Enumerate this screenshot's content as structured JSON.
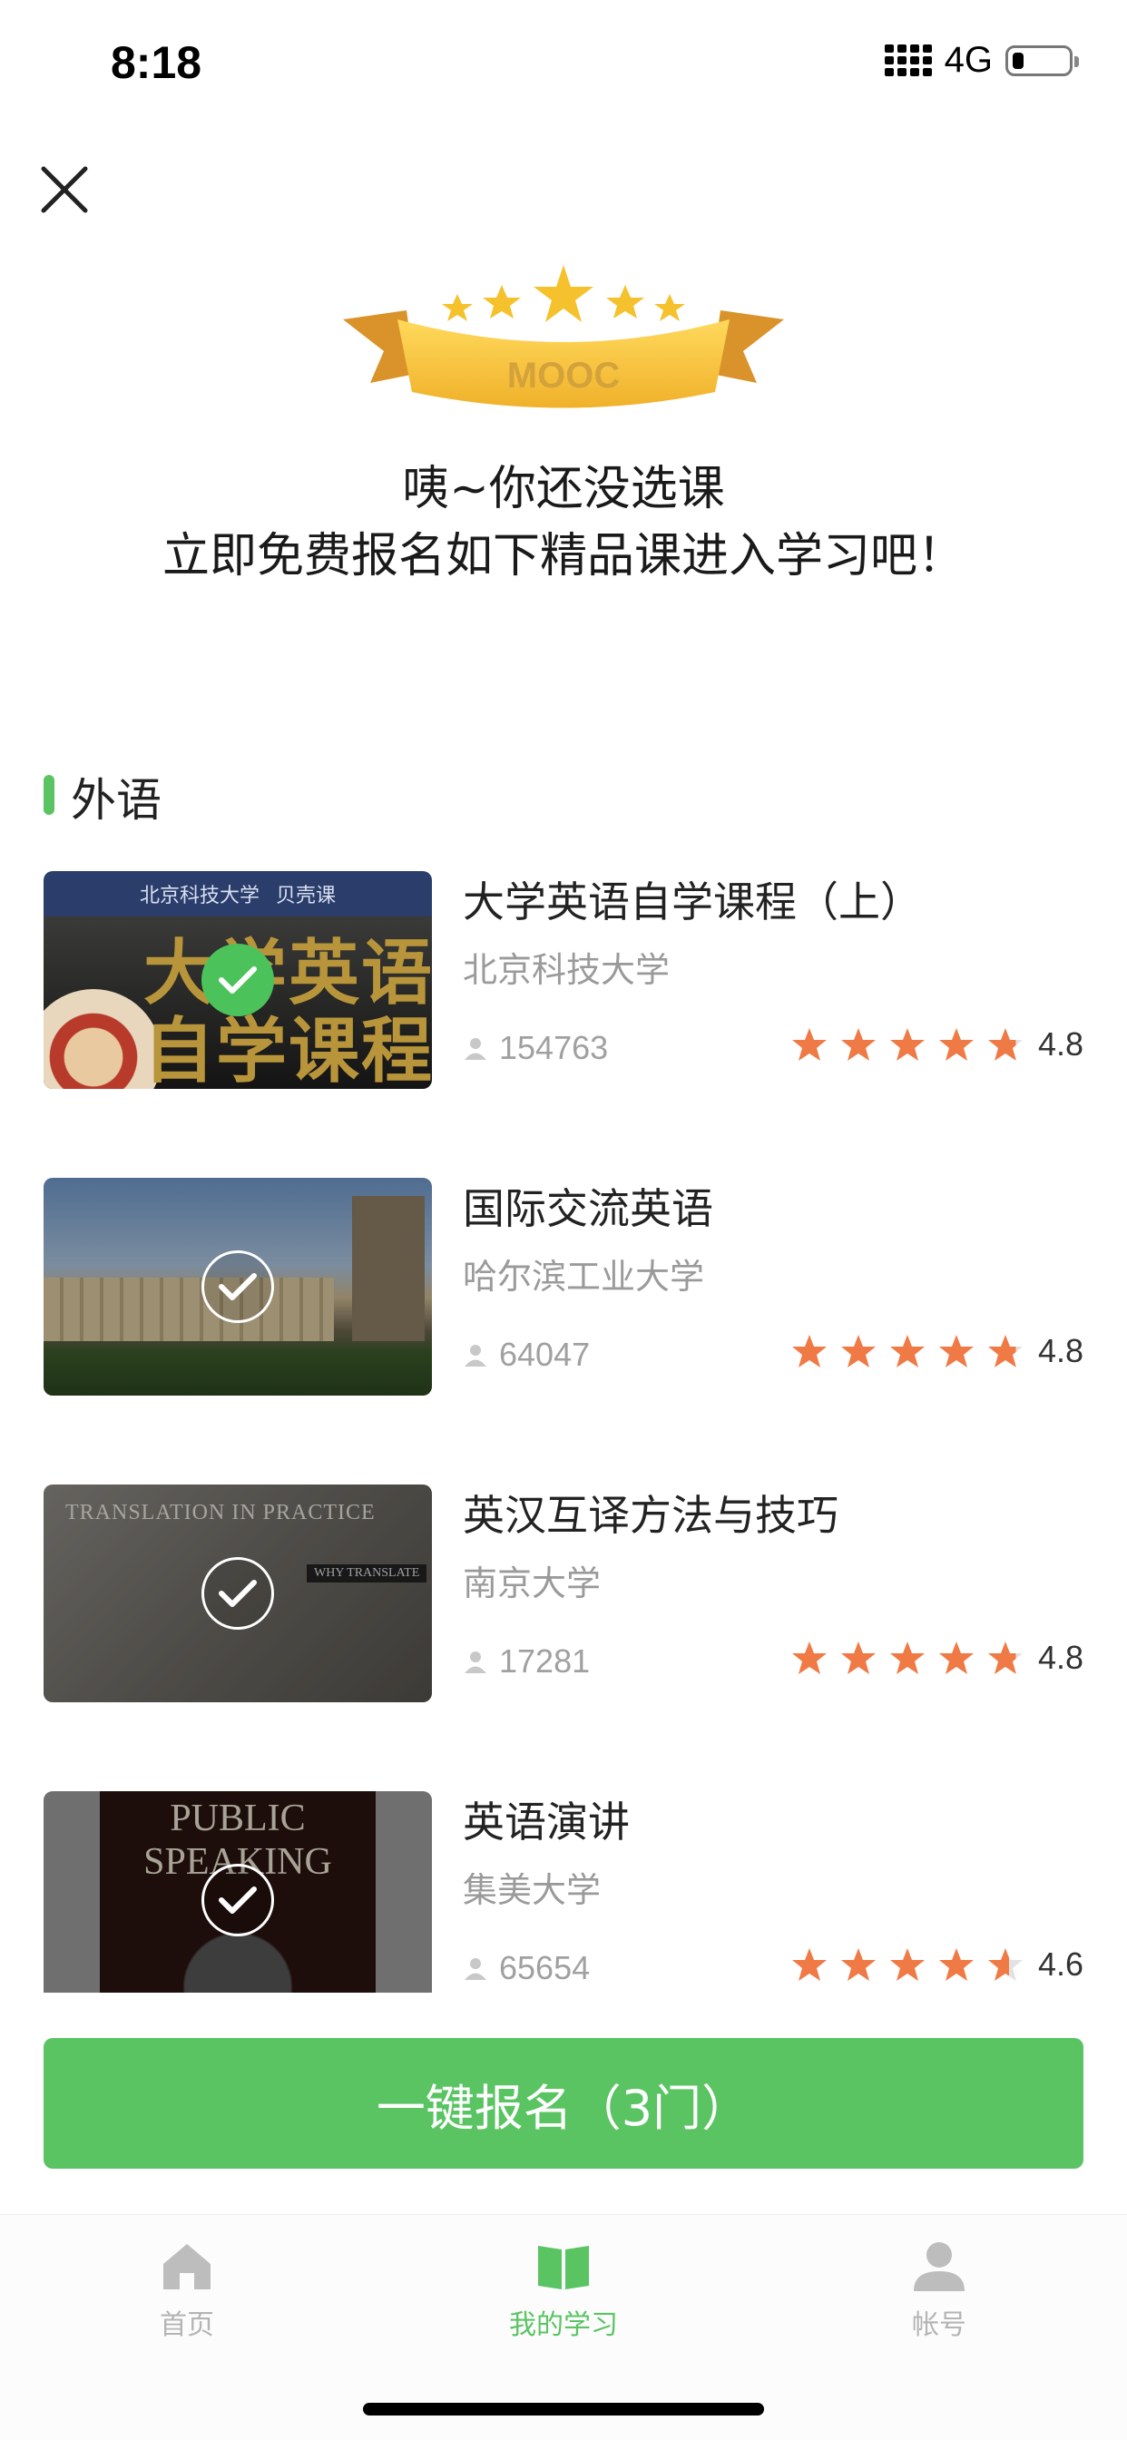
{
  "status_bar": {
    "time": "8:18",
    "network": "4G",
    "battery_level": 0.2
  },
  "header": {
    "line1": "咦~你还没选课",
    "line2": "立即免费报名如下精品课进入学习吧！"
  },
  "badge": {
    "text": "MOOC"
  },
  "section": {
    "title": "外语"
  },
  "courses": [
    {
      "title": "大学英语自学课程（上）",
      "school": "北京科技大学",
      "learners": "154763",
      "rating": "4.8",
      "selected": true,
      "thumb": {
        "school_logo": "北京科技大学",
        "platform": "贝壳课",
        "text": "大学英语\n自学课程"
      }
    },
    {
      "title": "国际交流英语",
      "school": "哈尔滨工业大学",
      "learners": "64047",
      "rating": "4.8",
      "selected": false
    },
    {
      "title": "英汉互译方法与技巧",
      "school": "南京大学",
      "learners": "17281",
      "rating": "4.8",
      "selected": false,
      "thumb": {
        "text": "TRANSLATION IN PRACTICE",
        "subtext": "WHY TRANSLATE"
      }
    },
    {
      "title": "英语演讲",
      "school": "集美大学",
      "learners": "65654",
      "rating": "4.6",
      "selected": false,
      "thumb": {
        "text": "PUBLIC SPEAKING"
      }
    }
  ],
  "cta": {
    "label": "一键报名（3门）"
  },
  "tabs": [
    {
      "label": "首页",
      "icon": "home-icon",
      "active": false
    },
    {
      "label": "我的学习",
      "icon": "book-icon",
      "active": true
    },
    {
      "label": "帐号",
      "icon": "user-icon",
      "active": false
    }
  ],
  "colors": {
    "accent": "#5ac463",
    "star": "#f07a45",
    "muted": "#9a9a9a"
  }
}
